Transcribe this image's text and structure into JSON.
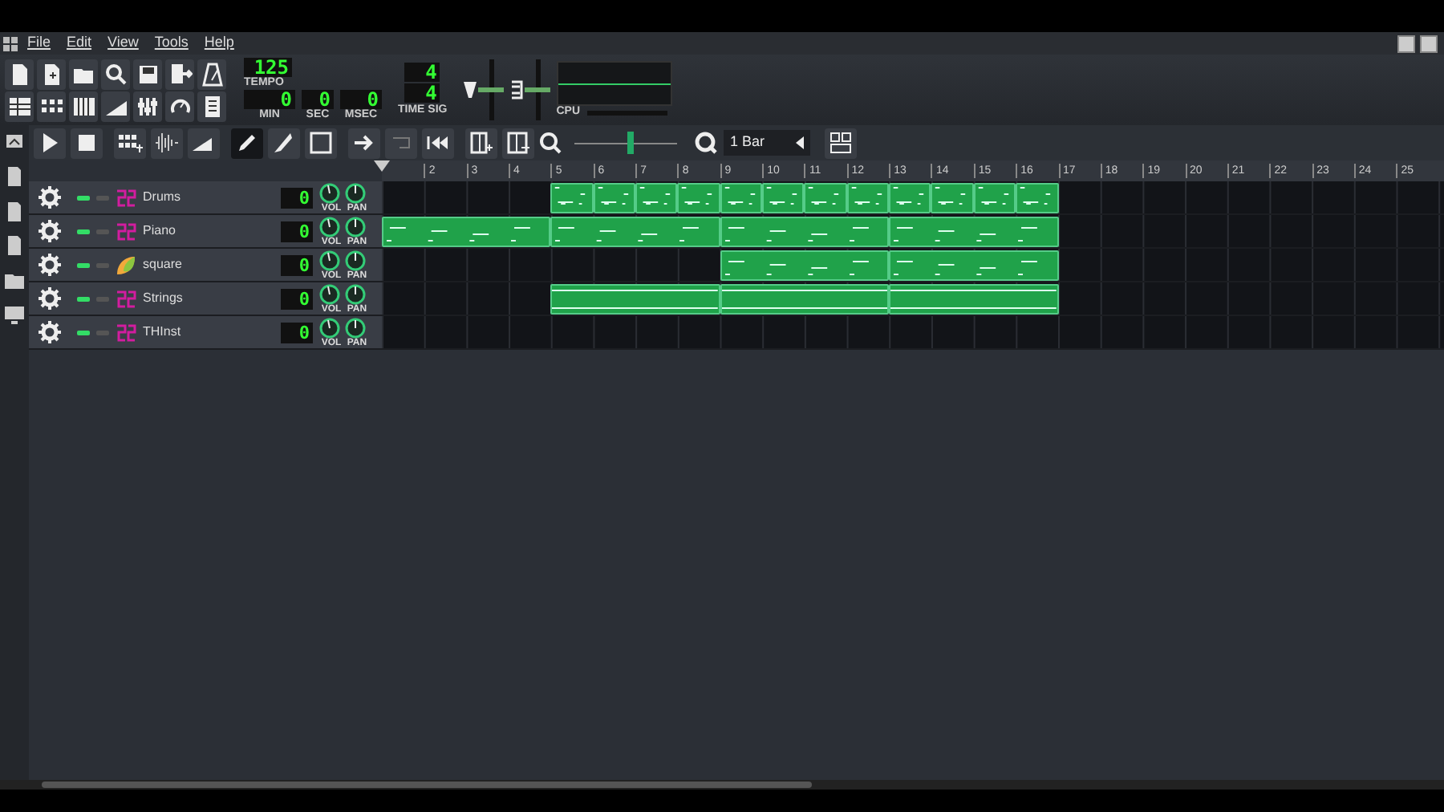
{
  "menu": [
    "File",
    "Edit",
    "View",
    "Tools",
    "Help"
  ],
  "lcd": {
    "tempo": "125",
    "tempo_label": "TEMPO",
    "min": "0",
    "min_label": "MIN",
    "sec": "0",
    "sec_label": "SEC",
    "msec": "0",
    "msec_label": "MSEC",
    "sig_num": "4",
    "sig_den": "4",
    "sig_label": "TIME SIG",
    "cpu_label": "CPU"
  },
  "master_volume": {
    "level": 0.5
  },
  "master_pitch": {
    "level": 0.5
  },
  "editor_tools": [
    {
      "kind": "play",
      "selected": false
    },
    {
      "kind": "stop",
      "selected": false
    },
    {
      "kind": "beat",
      "selected": false
    },
    {
      "kind": "sample",
      "selected": false
    },
    {
      "kind": "automation",
      "selected": false
    },
    {
      "kind": "draw",
      "selected": true
    },
    {
      "kind": "knife",
      "selected": false
    },
    {
      "kind": "select",
      "selected": false
    },
    {
      "kind": "arrow",
      "selected": false
    },
    {
      "kind": "loop",
      "selected": false
    },
    {
      "kind": "rewind",
      "selected": false
    },
    {
      "kind": "insertbar",
      "selected": false
    },
    {
      "kind": "removebar",
      "selected": false
    }
  ],
  "zoom": {
    "level": 0.55
  },
  "quantize": "1 Bar",
  "ruler": [
    "2",
    "3",
    "4",
    "5",
    "6",
    "7",
    "8",
    "9",
    "10",
    "11",
    "12",
    "13",
    "14",
    "15",
    "16",
    "17",
    "18",
    "19",
    "20",
    "21",
    "22",
    "23",
    "24",
    "25"
  ],
  "tracks": [
    {
      "name": "Drums",
      "kind": "kit",
      "muted": false,
      "solo": false,
      "value": "0",
      "vol_label": "VOL",
      "pan_label": "PAN",
      "cells": [
        {
          "kind": "empty"
        },
        {
          "kind": "empty"
        },
        {
          "kind": "empty"
        },
        {
          "kind": "empty"
        },
        {
          "kind": "beat"
        },
        {
          "kind": "beat"
        },
        {
          "kind": "beat"
        },
        {
          "kind": "beat"
        },
        {
          "kind": "beat"
        },
        {
          "kind": "beat"
        },
        {
          "kind": "beat"
        },
        {
          "kind": "beat"
        },
        {
          "kind": "beat"
        },
        {
          "kind": "beat"
        },
        {
          "kind": "beat"
        },
        {
          "kind": "beat"
        }
      ]
    },
    {
      "name": "Piano",
      "kind": "kit",
      "muted": false,
      "solo": false,
      "value": "0",
      "vol_label": "VOL",
      "pan_label": "PAN",
      "cells": [
        {
          "kind": "melody"
        },
        {
          "kind": "cont"
        },
        {
          "kind": "cont"
        },
        {
          "kind": "cont"
        },
        {
          "kind": "melody"
        },
        {
          "kind": "cont"
        },
        {
          "kind": "cont"
        },
        {
          "kind": "cont"
        },
        {
          "kind": "melody"
        },
        {
          "kind": "cont"
        },
        {
          "kind": "cont"
        },
        {
          "kind": "cont"
        },
        {
          "kind": "melody"
        },
        {
          "kind": "cont"
        },
        {
          "kind": "cont"
        },
        {
          "kind": "cont"
        }
      ]
    },
    {
      "name": "square",
      "kind": "synth",
      "muted": false,
      "solo": false,
      "value": "0",
      "vol_label": "VOL",
      "pan_label": "PAN",
      "cells": [
        {
          "kind": "empty"
        },
        {
          "kind": "empty"
        },
        {
          "kind": "empty"
        },
        {
          "kind": "empty"
        },
        {
          "kind": "empty"
        },
        {
          "kind": "empty"
        },
        {
          "kind": "empty"
        },
        {
          "kind": "empty"
        },
        {
          "kind": "melody"
        },
        {
          "kind": "cont"
        },
        {
          "kind": "cont"
        },
        {
          "kind": "cont"
        },
        {
          "kind": "melody"
        },
        {
          "kind": "cont"
        },
        {
          "kind": "cont"
        },
        {
          "kind": "cont"
        }
      ]
    },
    {
      "name": "Strings",
      "kind": "kit",
      "muted": false,
      "solo": false,
      "value": "0",
      "vol_label": "VOL",
      "pan_label": "PAN",
      "cells": [
        {
          "kind": "empty"
        },
        {
          "kind": "empty"
        },
        {
          "kind": "empty"
        },
        {
          "kind": "empty"
        },
        {
          "kind": "pad"
        },
        {
          "kind": "cont"
        },
        {
          "kind": "cont"
        },
        {
          "kind": "cont"
        },
        {
          "kind": "pad"
        },
        {
          "kind": "cont"
        },
        {
          "kind": "cont"
        },
        {
          "kind": "cont"
        },
        {
          "kind": "pad"
        },
        {
          "kind": "cont"
        },
        {
          "kind": "cont"
        },
        {
          "kind": "cont"
        }
      ]
    },
    {
      "name": "THInst",
      "kind": "kit",
      "muted": false,
      "solo": false,
      "value": "0",
      "vol_label": "VOL",
      "pan_label": "PAN"
    }
  ]
}
